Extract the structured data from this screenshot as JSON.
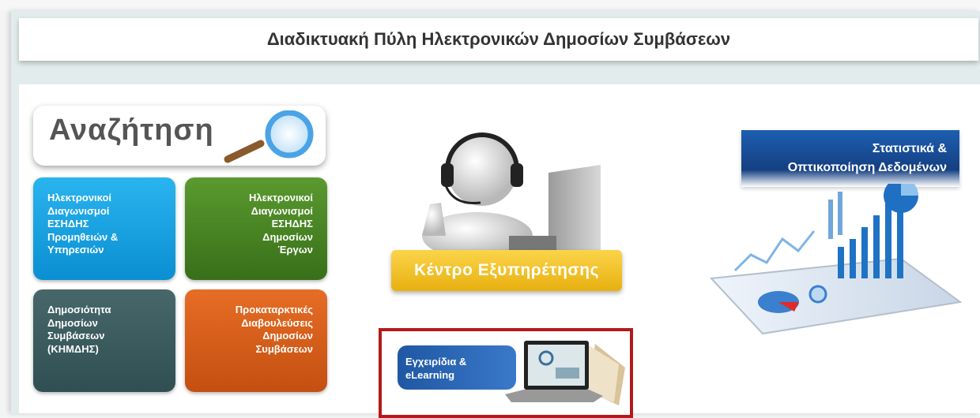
{
  "header": {
    "title": "Διαδικτυακή Πύλη Ηλεκτρονικών Δημοσίων Συμβάσεων"
  },
  "search": {
    "label": "Αναζήτηση"
  },
  "tiles": [
    {
      "label": "Ηλεκτρονικοί\nΔιαγωνισμοί\nΕΣΗΔΗΣ\nΠρομηθειών &\nΥπηρεσιών",
      "color": "#0a8fd2"
    },
    {
      "label": "Ηλεκτρονικοί\nΔιαγωνισμοί\nΕΣΗΔΗΣ\nΔημοσίων\nΈργων",
      "color": "#386f19"
    },
    {
      "label": "Δημοσιότητα\nΔημοσίων\nΣυμβάσεων\n(ΚΗΜΔΗΣ)",
      "color": "#2f4f53"
    },
    {
      "label": "Προκαταρκτικές\nΔιαβουλεύσεις\nΔημοσίων\nΣυμβάσεων",
      "color": "#c44f10"
    }
  ],
  "helpdesk": {
    "label": "Κέντρο Εξυπηρέτησης",
    "icon": "headset-person-icon"
  },
  "manuals": {
    "label": "Εγχειρίδια &\neLearning",
    "icon": "laptop-book-icon",
    "highlight": "#b3191c"
  },
  "stats": {
    "label": "Στατιστικά &\nΟπτικοποίηση Δεδομένων",
    "icon": "tablet-chart-icon"
  }
}
